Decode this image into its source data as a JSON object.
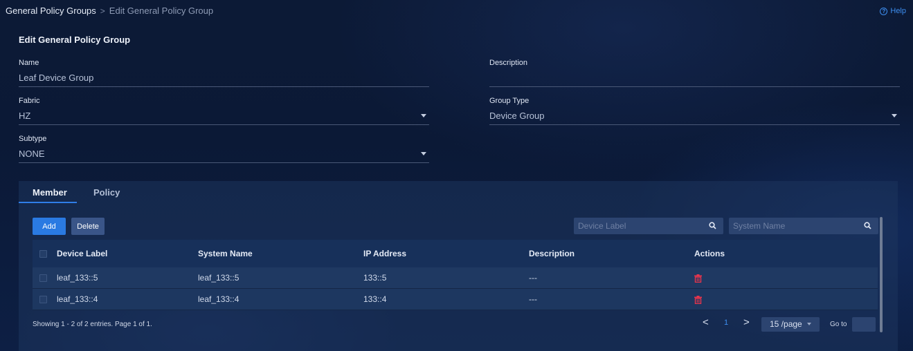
{
  "breadcrumb": {
    "parent": "General Policy Groups",
    "separator": ">",
    "current": "Edit General Policy Group"
  },
  "help": {
    "icon": "question-circle-icon",
    "label": "Help"
  },
  "page_title": "Edit General Policy Group",
  "form": {
    "name": {
      "label": "Name",
      "value": "Leaf Device Group"
    },
    "description": {
      "label": "Description",
      "value": ""
    },
    "fabric": {
      "label": "Fabric",
      "value": "HZ"
    },
    "group_type": {
      "label": "Group Type",
      "value": "Device Group"
    },
    "subtype": {
      "label": "Subtype",
      "value": "NONE"
    }
  },
  "tabs": [
    {
      "label": "Member",
      "active": true
    },
    {
      "label": "Policy",
      "active": false
    }
  ],
  "toolbar": {
    "add_label": "Add",
    "delete_label": "Delete",
    "device_label_placeholder": "Device Label",
    "system_name_placeholder": "System Name"
  },
  "table": {
    "columns": [
      "Device Label",
      "System Name",
      "IP Address",
      "Description",
      "Actions"
    ],
    "rows": [
      {
        "device_label": "leaf_133::5",
        "system_name": "leaf_133::5",
        "ip_address": "133::5",
        "description": "---"
      },
      {
        "device_label": "leaf_133::4",
        "system_name": "leaf_133::4",
        "ip_address": "133::4",
        "description": "---"
      }
    ]
  },
  "pagination": {
    "summary": "Showing 1 - 2 of 2 entries. Page 1 of 1.",
    "prev": "<",
    "current_page": "1",
    "next": ">",
    "page_size": "15 /page",
    "goto_label": "Go to",
    "goto_value": ""
  },
  "colors": {
    "accent": "#2a7ae2",
    "link": "#3d8ef0",
    "danger": "#e8344c",
    "panel": "#1e3462"
  }
}
